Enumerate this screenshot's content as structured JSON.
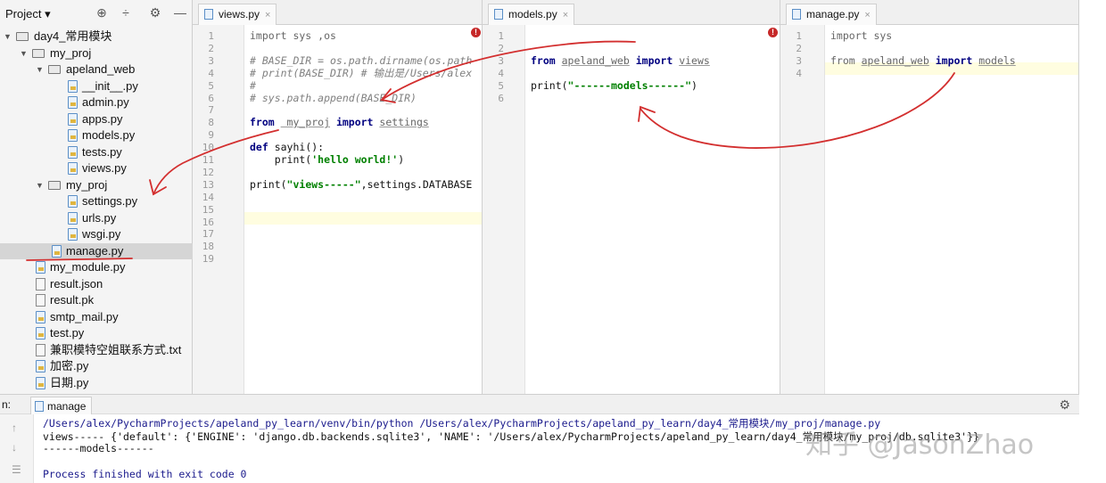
{
  "project_panel": {
    "title": "Project ▾",
    "tree": [
      {
        "label": "day4_常用模块",
        "kind": "folder",
        "open": true,
        "depth": 0
      },
      {
        "label": "my_proj",
        "kind": "folder",
        "open": true,
        "depth": 1
      },
      {
        "label": "apeland_web",
        "kind": "folder",
        "open": true,
        "depth": 2
      },
      {
        "label": "__init__.py",
        "kind": "py",
        "depth": 3
      },
      {
        "label": "admin.py",
        "kind": "py",
        "depth": 3
      },
      {
        "label": "apps.py",
        "kind": "py",
        "depth": 3
      },
      {
        "label": "models.py",
        "kind": "py",
        "depth": 3
      },
      {
        "label": "tests.py",
        "kind": "py",
        "depth": 3
      },
      {
        "label": "views.py",
        "kind": "py",
        "depth": 3
      },
      {
        "label": "my_proj",
        "kind": "folder",
        "open": true,
        "depth": 2
      },
      {
        "label": "settings.py",
        "kind": "py",
        "depth": 3
      },
      {
        "label": "urls.py",
        "kind": "py",
        "depth": 3
      },
      {
        "label": "wsgi.py",
        "kind": "py",
        "depth": 3
      },
      {
        "label": "manage.py",
        "kind": "py",
        "depth": 2,
        "selected": true
      },
      {
        "label": "my_module.py",
        "kind": "py",
        "depth": 1
      },
      {
        "label": "result.json",
        "kind": "doc",
        "depth": 1
      },
      {
        "label": "result.pk",
        "kind": "doc",
        "depth": 1
      },
      {
        "label": "smtp_mail.py",
        "kind": "py",
        "depth": 1
      },
      {
        "label": "test.py",
        "kind": "py",
        "depth": 1
      },
      {
        "label": "兼职模特空姐联系方式.txt",
        "kind": "doc",
        "depth": 1
      },
      {
        "label": "加密.py",
        "kind": "py",
        "depth": 1
      },
      {
        "label": "日期.py",
        "kind": "py",
        "depth": 1
      }
    ]
  },
  "editors": {
    "views": {
      "tab": "views.py",
      "line_numbers": [
        "1",
        "2",
        "3",
        "4",
        "5",
        "6",
        "7",
        "8",
        "9",
        "10",
        "11",
        "12",
        "13",
        "14",
        "15",
        "16",
        "17",
        "18",
        "19"
      ],
      "lines": [
        {
          "n": 1,
          "parts": [
            {
              "t": "import sys ,os",
              "c": "gray"
            }
          ]
        },
        {
          "n": 3,
          "parts": [
            {
              "t": "# BASE_DIR = os.path.dirname(os.path",
              "c": "cm"
            }
          ]
        },
        {
          "n": 4,
          "parts": [
            {
              "t": "# print(BASE_DIR) # 输出是/Users/alex",
              "c": "cm"
            }
          ]
        },
        {
          "n": 5,
          "parts": [
            {
              "t": "#",
              "c": "cm"
            }
          ]
        },
        {
          "n": 6,
          "parts": [
            {
              "t": "# sys.path.append(BASE_DIR)",
              "c": "cm"
            }
          ]
        },
        {
          "n": 8,
          "parts": [
            {
              "t": "from ",
              "c": "kw"
            },
            {
              "t": " my_proj",
              "c": "ul"
            },
            {
              "t": " import ",
              "c": "kw"
            },
            {
              "t": "settings",
              "c": "ul"
            }
          ]
        },
        {
          "n": 10,
          "parts": [
            {
              "t": "def ",
              "c": "kw"
            },
            {
              "t": "sayhi():",
              "c": ""
            }
          ]
        },
        {
          "n": 11,
          "parts": [
            {
              "t": "    print(",
              "c": ""
            },
            {
              "t": "'hello world!'",
              "c": "st"
            },
            {
              "t": ")",
              "c": ""
            }
          ]
        },
        {
          "n": 13,
          "parts": [
            {
              "t": "print(",
              "c": ""
            },
            {
              "t": "\"views-----\"",
              "c": "st"
            },
            {
              "t": ",settings.DATABASE",
              "c": ""
            }
          ]
        }
      ]
    },
    "models": {
      "tab": "models.py",
      "line_numbers": [
        "1",
        "2",
        "3",
        "4",
        "5",
        "6"
      ],
      "lines": [
        {
          "n": 3,
          "parts": [
            {
              "t": "from ",
              "c": "kw"
            },
            {
              "t": "apeland_web",
              "c": "ul"
            },
            {
              "t": " import ",
              "c": "kw"
            },
            {
              "t": "views",
              "c": "ul"
            }
          ]
        },
        {
          "n": 5,
          "parts": [
            {
              "t": "print(",
              "c": ""
            },
            {
              "t": "\"------models------\"",
              "c": "st"
            },
            {
              "t": ")",
              "c": ""
            }
          ]
        }
      ]
    },
    "manage": {
      "tab": "manage.py",
      "line_numbers": [
        "1",
        "2",
        "3",
        "4"
      ],
      "lines": [
        {
          "n": 1,
          "parts": [
            {
              "t": "import sys",
              "c": "gray"
            }
          ]
        },
        {
          "n": 3,
          "parts": [
            {
              "t": "from ",
              "c": "gray"
            },
            {
              "t": "apeland_web",
              "c": "ul"
            },
            {
              "t": " import ",
              "c": "kw"
            },
            {
              "t": "models",
              "c": "ul"
            }
          ]
        }
      ]
    }
  },
  "run_panel": {
    "prefix": "n:",
    "tab": "manage",
    "output": [
      {
        "text": "/Users/alex/PycharmProjects/apeland_py_learn/venv/bin/python /Users/alex/PycharmProjects/apeland_py_learn/day4_常用模块/my_proj/manage.py",
        "c": "out-path"
      },
      {
        "text": "views----- {'default': {'ENGINE': 'django.db.backends.sqlite3', 'NAME': '/Users/alex/PycharmProjects/apeland_py_learn/day4_常用模块/my_proj/db.sqlite3'}}",
        "c": ""
      },
      {
        "text": "------models------",
        "c": ""
      },
      {
        "text": "",
        "c": ""
      },
      {
        "text": "Process finished with exit code 0",
        "c": "out-path"
      }
    ]
  },
  "watermark": "知乎 @JasonZhao",
  "colors": {
    "annotation": "#d32f2f",
    "keyword": "#000080",
    "string": "#008000",
    "comment": "#808080"
  }
}
